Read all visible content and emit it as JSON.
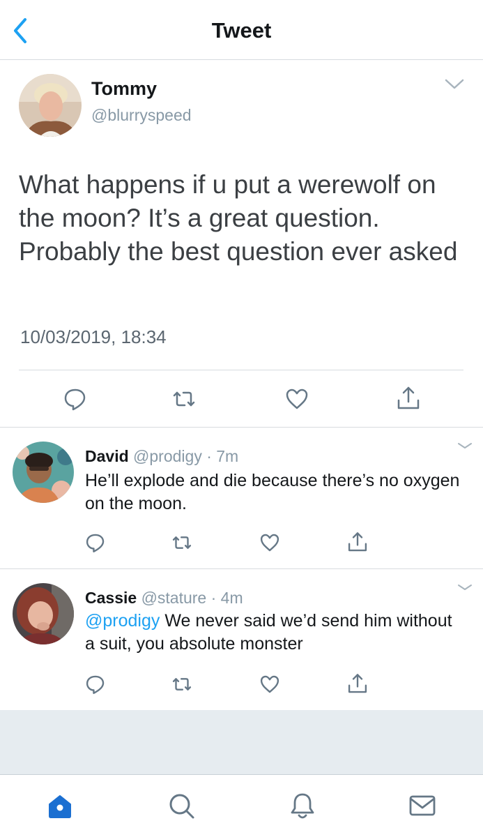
{
  "header": {
    "title": "Tweet"
  },
  "main_tweet": {
    "author_name": "Tommy",
    "author_handle": "@blurryspeed",
    "text": "What happens if u put a werewolf on the moon? It’s a great question. Probably the best question ever asked",
    "timestamp": "10/03/2019, 18:34"
  },
  "replies": [
    {
      "name": "David",
      "handle": "@prodigy",
      "time": "· 7m",
      "text": "He’ll explode and die because there’s no oxygen on the moon."
    },
    {
      "name": "Cassie",
      "handle": "@stature",
      "time": "· 4m",
      "mention": "@prodigy",
      "text": " We never said we’d send him without a suit, you absolute monster"
    }
  ],
  "colors": {
    "accent": "#1da1f2",
    "nav_active": "#1b6fd1",
    "icon_gray": "#657786",
    "text": "#14171a",
    "muted": "#8899a6"
  },
  "icons": [
    "back-chevron",
    "chevron-down",
    "reply",
    "retweet",
    "like",
    "share",
    "home",
    "search",
    "notifications",
    "messages"
  ]
}
